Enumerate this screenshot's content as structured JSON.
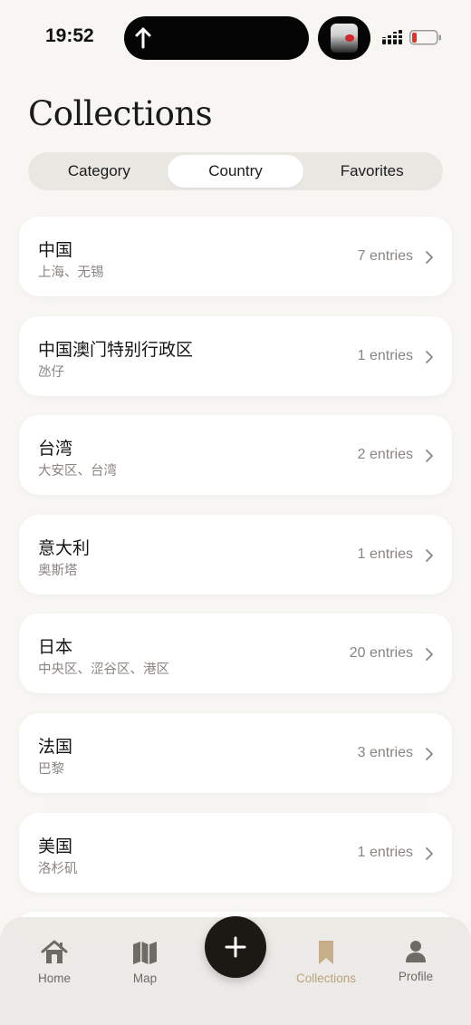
{
  "status_bar": {
    "time": "19:52",
    "icons": [
      "navigation-arrow-icon",
      "avatar-icon",
      "signal-icon",
      "battery-low-icon"
    ]
  },
  "header": {
    "title": "Collections"
  },
  "segments": {
    "items": [
      "Category",
      "Country",
      "Favorites"
    ],
    "selected": "Country"
  },
  "collections": [
    {
      "title": "中国",
      "subtitle": "上海、无锡",
      "count": "7 entries"
    },
    {
      "title": "中国澳门特别行政区",
      "subtitle": "氹仔",
      "count": "1 entries"
    },
    {
      "title": "台湾",
      "subtitle": "大安区、台湾",
      "count": "2 entries"
    },
    {
      "title": "意大利",
      "subtitle": "奥斯塔",
      "count": "1 entries"
    },
    {
      "title": "日本",
      "subtitle": "中央区、涩谷区、港区",
      "count": "20 entries"
    },
    {
      "title": "法国",
      "subtitle": "巴黎",
      "count": "3 entries"
    },
    {
      "title": "美国",
      "subtitle": "洛杉矶",
      "count": "1 entries"
    }
  ],
  "tab_bar": {
    "items": [
      {
        "label": "Home",
        "icon": "home-icon"
      },
      {
        "label": "Map",
        "icon": "map-icon"
      },
      {
        "label": "Collections",
        "icon": "bookmark-icon"
      },
      {
        "label": "Profile",
        "icon": "person-icon"
      }
    ],
    "active": "Collections",
    "add_icon": "plus-icon"
  },
  "colors": {
    "background": "#f7f6f3",
    "accent": "#b9a17f",
    "fab": "#1c1915"
  }
}
